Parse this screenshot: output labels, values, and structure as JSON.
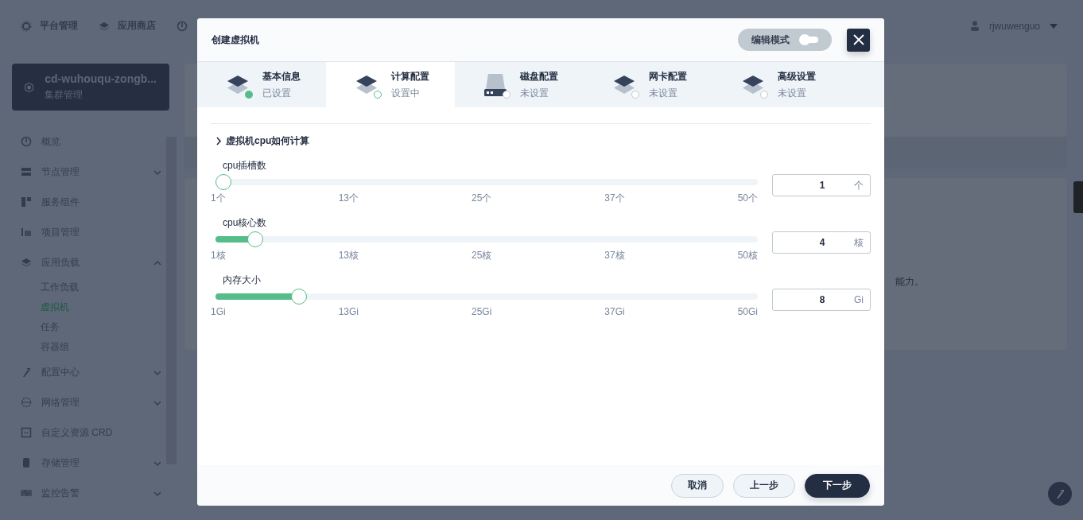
{
  "top_nav": {
    "items": [
      {
        "label": "平台管理",
        "kind": "gear"
      },
      {
        "label": "应用商店",
        "kind": "layers"
      }
    ],
    "user": "rjwuwenguo"
  },
  "cluster": {
    "name": "cd-wuhouqu-zongb...",
    "subtitle": "集群管理"
  },
  "sidebar": {
    "items": [
      {
        "label": "概览",
        "kind": "link",
        "selected": false
      },
      {
        "label": "节点管理",
        "kind": "group",
        "selected": false,
        "expanded": false
      },
      {
        "label": "服务组件",
        "kind": "link",
        "selected": false
      },
      {
        "label": "项目管理",
        "kind": "link",
        "selected": false
      },
      {
        "label": "应用负载",
        "kind": "group",
        "selected": false,
        "expanded": true,
        "children": [
          {
            "label": "工作负载",
            "selected": false
          },
          {
            "label": "虚拟机",
            "selected": true
          },
          {
            "label": "任务",
            "selected": false
          },
          {
            "label": "容器组",
            "selected": false
          }
        ]
      },
      {
        "label": "配置中心",
        "kind": "group",
        "selected": false,
        "expanded": false
      },
      {
        "label": "网络管理",
        "kind": "group",
        "selected": false,
        "expanded": false
      },
      {
        "label": "自定义资源 CRD",
        "kind": "link",
        "selected": false
      },
      {
        "label": "存储管理",
        "kind": "group",
        "selected": false,
        "expanded": false
      },
      {
        "label": "监控告警",
        "kind": "group",
        "selected": false,
        "expanded": false
      }
    ]
  },
  "content": {
    "card_text": "能力。"
  },
  "modal": {
    "title": "创建虚拟机",
    "edit_mode": {
      "label": "编辑模式",
      "on": false
    },
    "steps": [
      {
        "title": "基本信息",
        "status": "已设置",
        "done": true,
        "kind": "layers",
        "selected": false
      },
      {
        "title": "计算配置",
        "status": "设置中",
        "done": false,
        "kind": "layers",
        "selected": true
      },
      {
        "title": "磁盘配置",
        "status": "未设置",
        "done": false,
        "kind": "disk",
        "selected": false
      },
      {
        "title": "网卡配置",
        "status": "未设置",
        "done": false,
        "kind": "layers",
        "selected": false
      },
      {
        "title": "高级设置",
        "status": "未设置",
        "done": false,
        "kind": "layers",
        "selected": false
      }
    ],
    "help": {
      "label": "虚拟机cpu如何计算",
      "expanded": false
    },
    "sliders": [
      {
        "label": "cpu插槽数",
        "level": 0,
        "ticks": [
          "1个",
          "13个",
          "25个",
          "37个",
          "50个"
        ],
        "value": "1",
        "unit": "个"
      },
      {
        "label": "cpu核心数",
        "level": 0.061,
        "ticks": [
          "1核",
          "13核",
          "25核",
          "37核",
          "50核"
        ],
        "value": "4",
        "unit": "核"
      },
      {
        "label": "内存大小",
        "level": 0.143,
        "ticks": [
          "1Gi",
          "13Gi",
          "25Gi",
          "37Gi",
          "50Gi"
        ],
        "value": "8",
        "unit": "Gi"
      }
    ],
    "buttons": [
      {
        "label": "取消",
        "kind": "secondary"
      },
      {
        "label": "上一步",
        "kind": "secondary"
      },
      {
        "label": "下一步",
        "kind": "primary"
      }
    ]
  }
}
